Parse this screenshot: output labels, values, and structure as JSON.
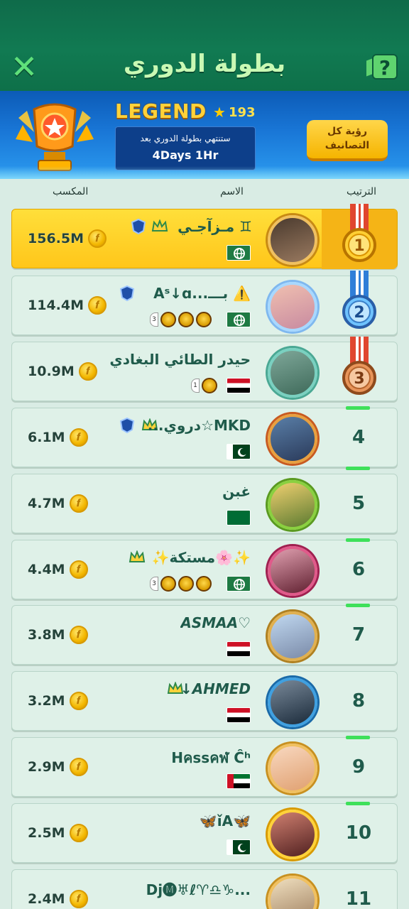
{
  "header": {
    "title": "بطولة الدوري",
    "close_icon": "close-icon",
    "help_label": "?"
  },
  "league": {
    "tier": "LEGEND",
    "stars": "193",
    "ends_label": "ستنتهي بطولة الدوري بعد",
    "ends_time": "4Days 1Hr",
    "view_all_line1": "رؤية كل",
    "view_all_line2": "التصانيف"
  },
  "columns": {
    "rank": "الترتيب",
    "name": "الاسم",
    "earnings": "المكسب"
  },
  "rows": [
    {
      "rank": "1",
      "name": "مـزآجـي ♊",
      "earn": "156.5M",
      "flag": "world",
      "medal": "gold"
    },
    {
      "rank": "2",
      "name": "Aˢ↓ɑ...بـــ ⚠️",
      "earn": "114.4M",
      "flag": "world",
      "medal": "silver"
    },
    {
      "rank": "3",
      "name": "حيدر الطائي البغادي",
      "earn": "10.9M",
      "flag": "iraq",
      "medal": "bronze"
    },
    {
      "rank": "4",
      "name": "...دروي☆MKD",
      "earn": "6.1M",
      "flag": "pakistan"
    },
    {
      "rank": "5",
      "name": "غبن",
      "earn": "4.7M",
      "flag": "saudi"
    },
    {
      "rank": "6",
      "name": "✨مستكة🌸✨",
      "earn": "4.4M",
      "flag": "world"
    },
    {
      "rank": "7",
      "name": "ASMAA♡",
      "earn": "3.8M",
      "flag": "egypt"
    },
    {
      "rank": "8",
      "name": "↓AHMED",
      "earn": "3.2M",
      "flag": "iraq"
    },
    {
      "rank": "9",
      "name": "Hคssคฬ Ĉʰ",
      "earn": "2.9M",
      "flag": "uae"
    },
    {
      "rank": "10",
      "name": "🦋ǐA🦋",
      "earn": "2.5M",
      "flag": "pakistan"
    },
    {
      "rank": "11",
      "name": "Dj🅜♅ℓ♈♎♑...",
      "earn": "2.4M",
      "flag": "world"
    }
  ],
  "coin_symbol": "𝒇",
  "colors": {
    "header_green": "#117a52",
    "banner_blue": "#1976d6",
    "row_bg": "#dff1e8",
    "first_row": "#ffc61a",
    "rank_text": "#1f5b4b"
  }
}
